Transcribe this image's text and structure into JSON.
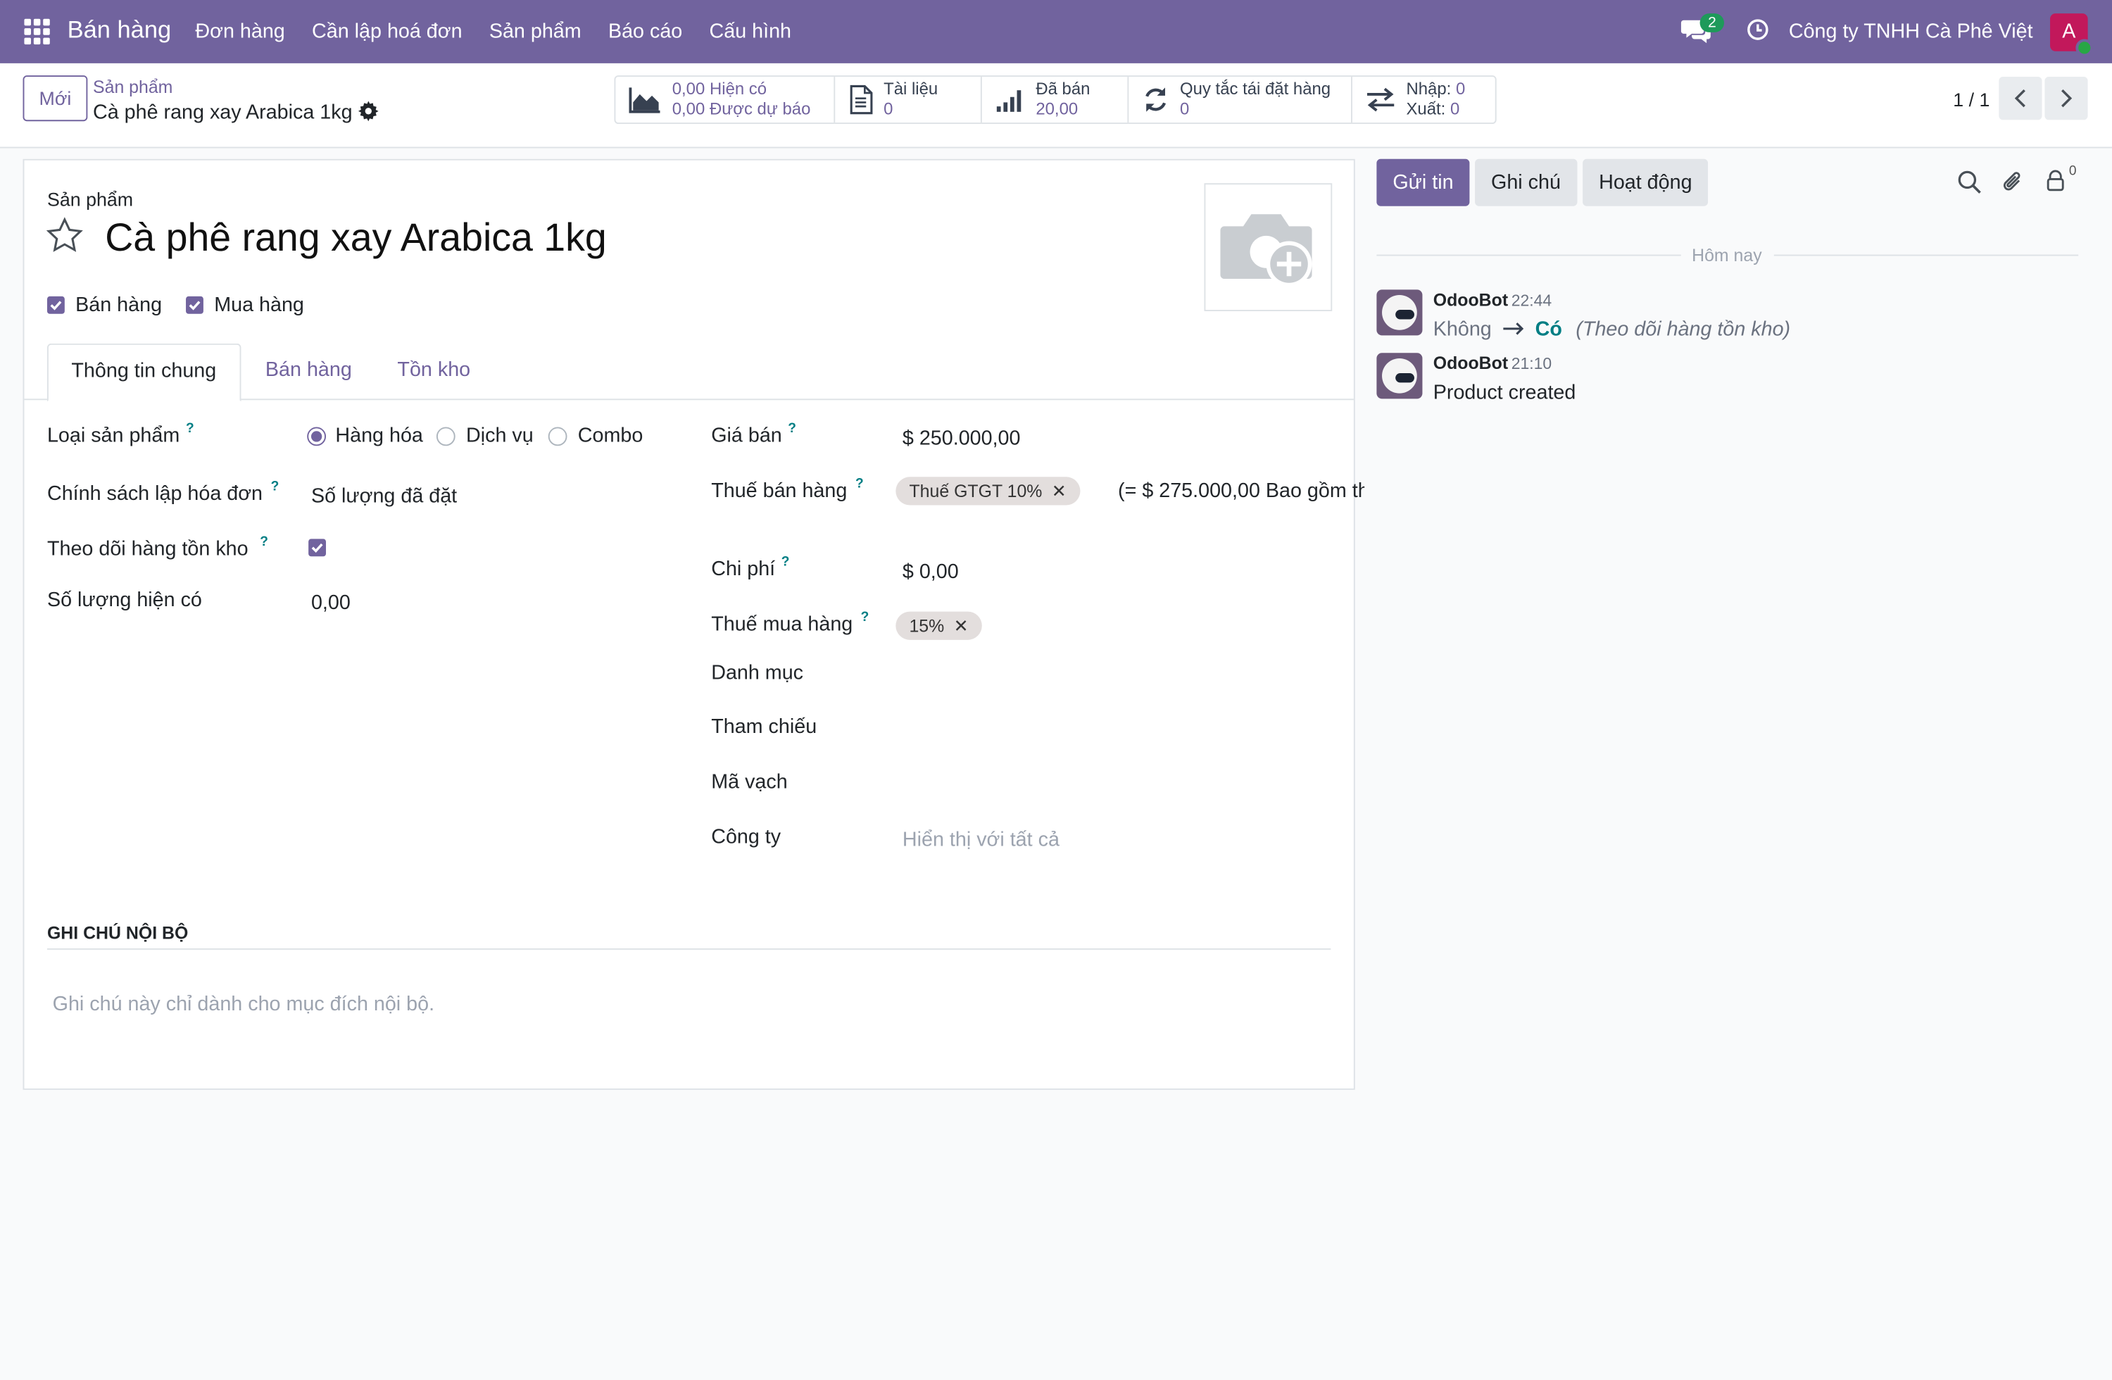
{
  "navbar": {
    "app_name": "Bán hàng",
    "menu": [
      "Đơn hàng",
      "Cần lập hoá đơn",
      "Sản phẩm",
      "Báo cáo",
      "Cấu hình"
    ],
    "chat_badge": "2",
    "company": "Công ty TNHH Cà Phê Việt",
    "avatar_letter": "A",
    "colors": {
      "bar": "#71639e",
      "badge": "#1e9a5a",
      "avatar": "#c2185b"
    }
  },
  "control": {
    "new_button": "Mới",
    "breadcrumb_parent": "Sản phẩm",
    "breadcrumb_current": "Cà phê rang xay Arabica 1kg",
    "smart_buttons": {
      "on_hand": {
        "value1": "0,00",
        "label1": "Hiện có",
        "value2": "0,00",
        "label2": "Được dự báo"
      },
      "documents": {
        "label": "Tài liệu",
        "value": "0"
      },
      "sold": {
        "label": "Đã bán",
        "value": "20,00"
      },
      "reorder": {
        "label": "Quy tắc tái đặt hàng",
        "value": "0"
      },
      "moves": {
        "in_label": "Nhập:",
        "in_value": "0",
        "out_label": "Xuất:",
        "out_value": "0"
      }
    },
    "pager": "1 / 1"
  },
  "form": {
    "section_label": "Sản phẩm",
    "product_name": "Cà phê rang xay Arabica 1kg",
    "can_be_sold": {
      "label": "Bán hàng",
      "checked": true
    },
    "can_be_purchased": {
      "label": "Mua hàng",
      "checked": true
    },
    "tabs": [
      "Thông tin chung",
      "Bán hàng",
      "Tồn kho"
    ],
    "active_tab": "Thông tin chung",
    "help_mark": "?",
    "left": {
      "product_type": {
        "label": "Loại sản phẩm",
        "options": [
          "Hàng hóa",
          "Dịch vụ",
          "Combo"
        ],
        "selected": "Hàng hóa"
      },
      "invoice_policy": {
        "label": "Chính sách lập hóa đơn",
        "value": "Số lượng đã đặt"
      },
      "track_inventory": {
        "label": "Theo dõi hàng tồn kho",
        "checked": true
      },
      "qty_on_hand": {
        "label": "Số lượng hiện có",
        "value": "0,00"
      }
    },
    "right": {
      "sales_price": {
        "label": "Giá bán",
        "value": "$ 250.000,00"
      },
      "sales_tax": {
        "label": "Thuế bán hàng",
        "tag": "Thuế GTGT 10%",
        "note": "(= $ 275.000,00 Bao gồm th"
      },
      "cost": {
        "label": "Chi phí",
        "value": "$ 0,00"
      },
      "purchase_tax": {
        "label": "Thuế mua hàng",
        "tag": "15%"
      },
      "category": {
        "label": "Danh mục",
        "value": ""
      },
      "reference": {
        "label": "Tham chiếu",
        "value": ""
      },
      "barcode": {
        "label": "Mã vạch",
        "value": ""
      },
      "company": {
        "label": "Công ty",
        "placeholder": "Hiển thị với tất cả"
      }
    },
    "internal_notes": {
      "heading": "GHI CHÚ NỘI BỘ",
      "placeholder": "Ghi chú này chỉ dành cho mục đích nội bộ."
    }
  },
  "chatter": {
    "buttons": {
      "send": "Gửi tin",
      "note": "Ghi chú",
      "activity": "Hoạt động"
    },
    "follower_count": "0",
    "date_separator": "Hôm nay",
    "messages": [
      {
        "author": "OdooBot",
        "time": "22:44",
        "old_value": "Không",
        "new_value": "Có",
        "field": "(Theo dõi hàng tồn kho)"
      },
      {
        "author": "OdooBot",
        "time": "21:10",
        "body": "Product created"
      }
    ]
  }
}
